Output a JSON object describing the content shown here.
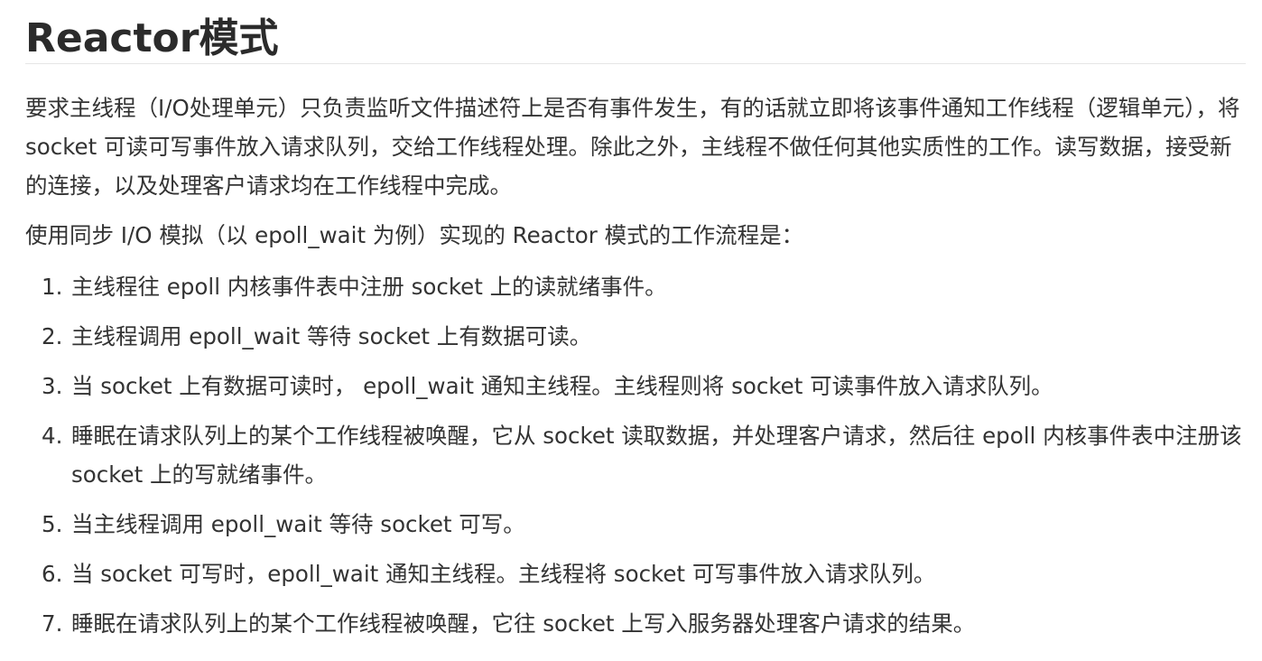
{
  "title": "Reactor模式",
  "paragraphs": [
    "要求主线程（I/O处理单元）只负责监听文件描述符上是否有事件发生，有的话就立即将该事件通知工作线程（逻辑单元），将 socket 可读可写事件放入请求队列，交给工作线程处理。除此之外，主线程不做任何其他实质性的工作。读写数据，接受新的连接，以及处理客户请求均在工作线程中完成。",
    "使用同步 I/O 模拟（以 epoll_wait 为例）实现的 Reactor 模式的工作流程是："
  ],
  "steps": [
    {
      "num": "1.",
      "text": "主线程往 epoll 内核事件表中注册 socket 上的读就绪事件。"
    },
    {
      "num": "2.",
      "text": "主线程调用 epoll_wait 等待 socket 上有数据可读。"
    },
    {
      "num": "3.",
      "text": "当 socket 上有数据可读时， epoll_wait 通知主线程。主线程则将 socket 可读事件放入请求队列。"
    },
    {
      "num": "4.",
      "text": "睡眠在请求队列上的某个工作线程被唤醒，它从 socket 读取数据，并处理客户请求，然后往 epoll 内核事件表中注册该 socket 上的写就绪事件。"
    },
    {
      "num": "5.",
      "text": "当主线程调用 epoll_wait 等待 socket 可写。"
    },
    {
      "num": "6.",
      "text": "当 socket 可写时，epoll_wait 通知主线程。主线程将 socket 可写事件放入请求队列。"
    },
    {
      "num": "7.",
      "text": "睡眠在请求队列上的某个工作线程被唤醒，它往 socket 上写入服务器处理客户请求的结果。"
    }
  ]
}
